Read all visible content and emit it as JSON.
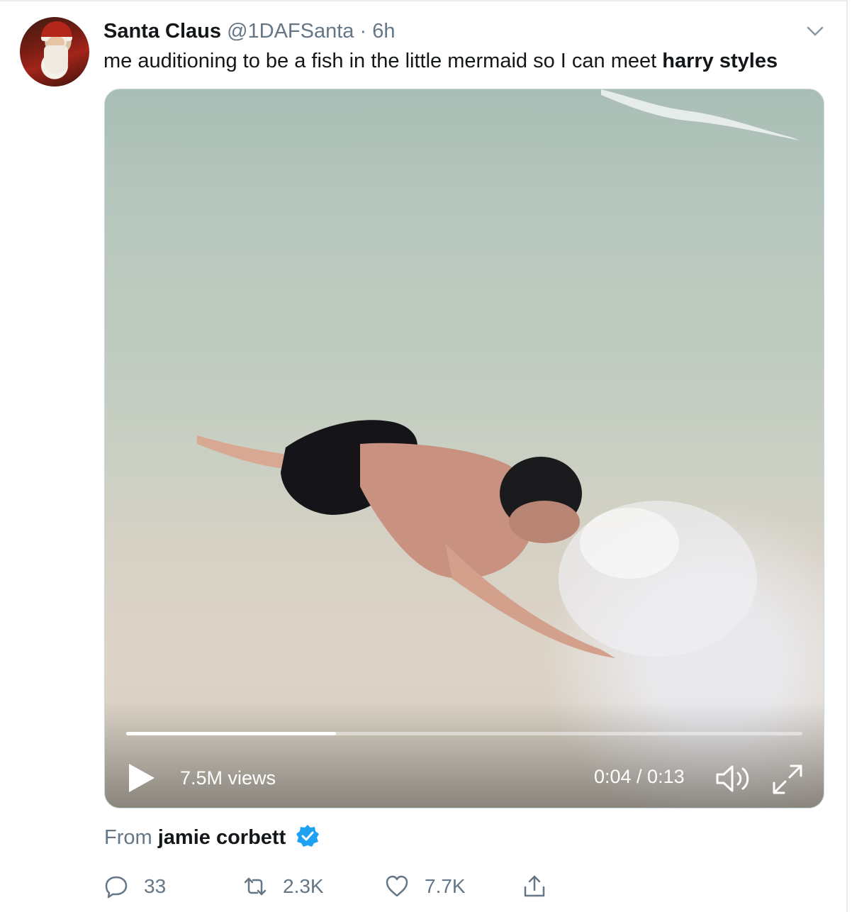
{
  "tweet": {
    "display_name": "Santa Claus",
    "handle": "@1DAFSanta",
    "separator": "·",
    "time": "6h",
    "text_plain": "me auditioning to be a fish in the little mermaid so I can meet ",
    "text_bold": "harry styles",
    "avatar_icon": "santa-avatar"
  },
  "video": {
    "views": "7.5M views",
    "current_time": "0:04",
    "duration": "0:13",
    "timecode": "0:04 / 0:13",
    "progress": 0.31
  },
  "source": {
    "prefix": "From",
    "author": "jamie corbett",
    "verified_color": "#1da1f2"
  },
  "actions": {
    "replies": "33",
    "retweets": "2.3K",
    "likes": "7.7K"
  },
  "colors": {
    "text": "#14171a",
    "secondary": "#657786",
    "border": "#e6ecf0"
  }
}
